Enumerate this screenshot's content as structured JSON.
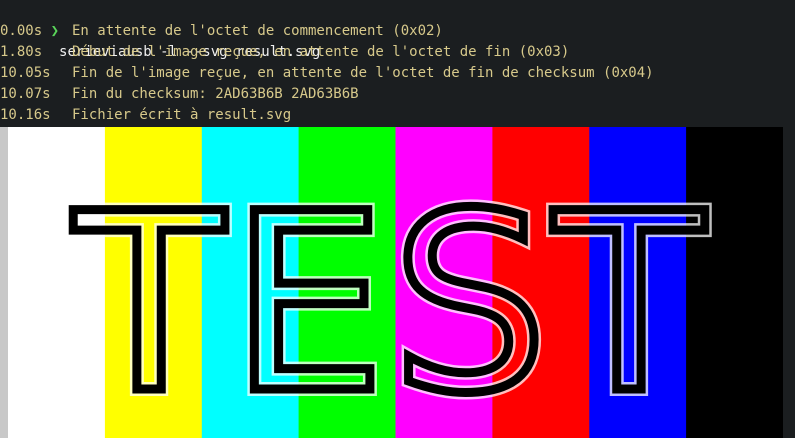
{
  "terminal": {
    "prompt_symbol": "❯",
    "command": "serieviausb -l --svg result.svg",
    "log": [
      {
        "time": "0.00s",
        "message": "En attente de l'octet de commencement (0x02)"
      },
      {
        "time": "1.80s",
        "message": "Début de l'image reçue, en attente de l'octet de fin (0x03)"
      },
      {
        "time": "10.05s",
        "message": "Fin de l'image reçue, en attente de l'octet de fin de checksum (0x04)"
      },
      {
        "time": "10.07s",
        "message": "Fin du checksum: 2AD63B6B 2AD63B6B"
      },
      {
        "time": "10.16s",
        "message": "Fichier écrit à result.svg"
      }
    ]
  },
  "image": {
    "text": "TEST",
    "bar_colors": [
      "#ffffff",
      "#ffff00",
      "#00ffff",
      "#00ff00",
      "#ff00ff",
      "#ff0000",
      "#0000ff",
      "#000000"
    ],
    "background": "#1b1e20",
    "ink": "#000000"
  }
}
